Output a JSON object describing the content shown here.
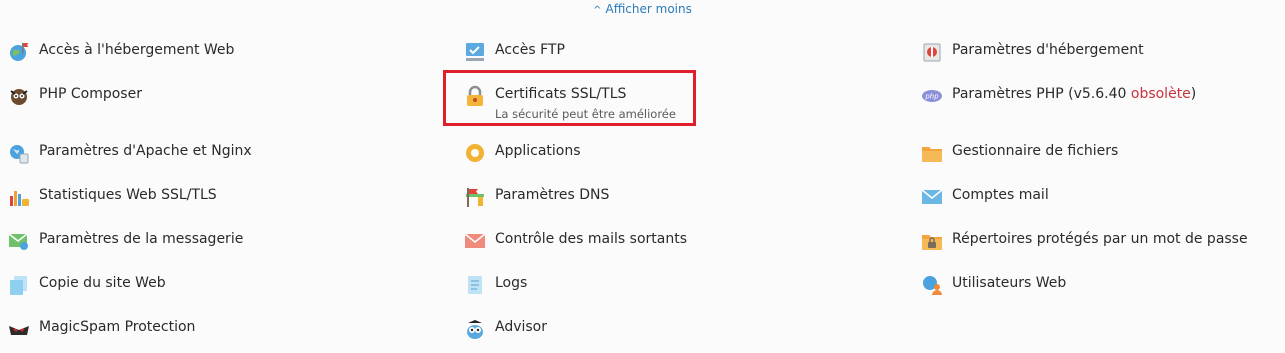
{
  "toggle": {
    "label": "Afficher moins",
    "icon": "chevron-up-icon"
  },
  "col1": [
    {
      "label": "Accès à l'hébergement Web",
      "icon": "globe-flag-icon"
    },
    {
      "label": "PHP Composer",
      "icon": "composer-icon"
    },
    {
      "label": "Paramètres d'Apache et Nginx",
      "icon": "apache-nginx-icon"
    },
    {
      "label": "Statistiques Web SSL/TLS",
      "icon": "stats-icon"
    },
    {
      "label": "Paramètres de la messagerie",
      "icon": "mail-settings-icon"
    },
    {
      "label": "Copie du site Web",
      "icon": "copy-site-icon"
    },
    {
      "label": "MagicSpam Protection",
      "icon": "magicspam-icon"
    }
  ],
  "col2": [
    {
      "label": "Accès FTP",
      "icon": "ftp-icon"
    },
    {
      "label": "Certificats SSL/TLS",
      "sub": "La sécurité peut être améliorée",
      "icon": "lock-icon"
    },
    {
      "label": "Applications",
      "icon": "applications-gear-icon"
    },
    {
      "label": "Paramètres DNS",
      "icon": "dns-icon"
    },
    {
      "label": "Contrôle des mails sortants",
      "icon": "outgoing-mail-icon"
    },
    {
      "label": "Logs",
      "icon": "logs-icon"
    },
    {
      "label": "Advisor",
      "icon": "owl-icon"
    }
  ],
  "col3": [
    {
      "label": "Paramètres d'hébergement",
      "icon": "hosting-settings-icon"
    },
    {
      "label": "Paramètres PHP (v5.6.40 ",
      "label_warn": "obsolète",
      "label_end": ")",
      "icon": "php-icon"
    },
    {
      "label": "Gestionnaire de fichiers",
      "icon": "folder-icon"
    },
    {
      "label": "Comptes mail",
      "icon": "mail-icon"
    },
    {
      "label": "Répertoires protégés par un mot de passe",
      "icon": "protected-folder-icon"
    },
    {
      "label": "Utilisateurs Web",
      "icon": "web-users-icon"
    }
  ],
  "colors": {
    "link": "#2b7bb9",
    "obsolete": "#c9313b",
    "highlight": "#e01f2a"
  }
}
